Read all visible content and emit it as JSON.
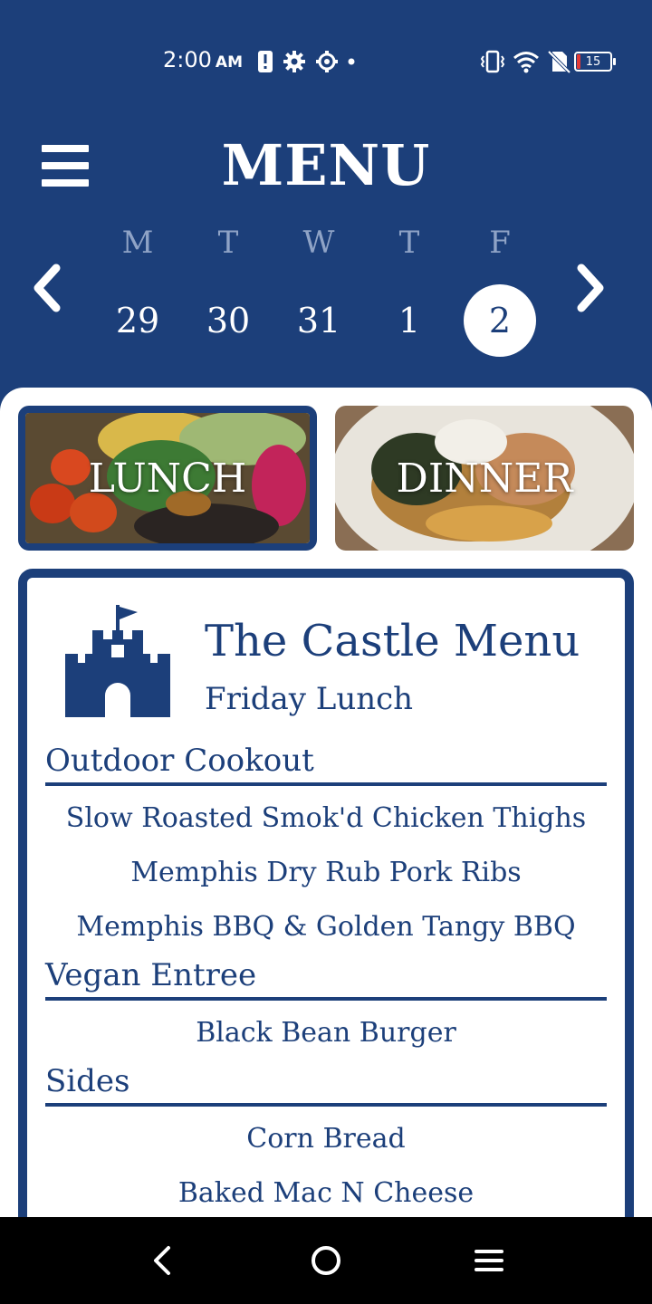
{
  "status_bar": {
    "time": "2:00",
    "ampm": "AM",
    "battery": "15"
  },
  "header": {
    "title": "MENU"
  },
  "week": {
    "days": [
      "M",
      "T",
      "W",
      "T",
      "F"
    ],
    "dates": [
      "29",
      "30",
      "31",
      "1",
      "2"
    ],
    "selected_date": "2"
  },
  "meal_tabs": {
    "lunch": "LUNCH",
    "dinner": "DINNER",
    "selected": "LUNCH"
  },
  "menu": {
    "title": "The Castle Menu",
    "subtitle": "Friday Lunch",
    "sections": [
      {
        "name": "Outdoor Cookout",
        "items": [
          "Slow Roasted Smok'd Chicken Thighs",
          "Memphis Dry Rub Pork Ribs",
          "Memphis BBQ & Golden Tangy BBQ"
        ]
      },
      {
        "name": "Vegan Entree",
        "items": [
          "Black Bean Burger"
        ]
      },
      {
        "name": "Sides",
        "items": [
          "Corn Bread",
          "Baked Mac N Cheese"
        ]
      }
    ]
  },
  "colors": {
    "primary": "#1c3f7a",
    "background": "#ffffff",
    "muted_day": "#8fa3c6"
  },
  "icons": [
    "menu-icon",
    "chevron-left-icon",
    "chevron-right-icon",
    "castle-icon",
    "back-icon",
    "home-icon",
    "recent-apps-icon"
  ]
}
